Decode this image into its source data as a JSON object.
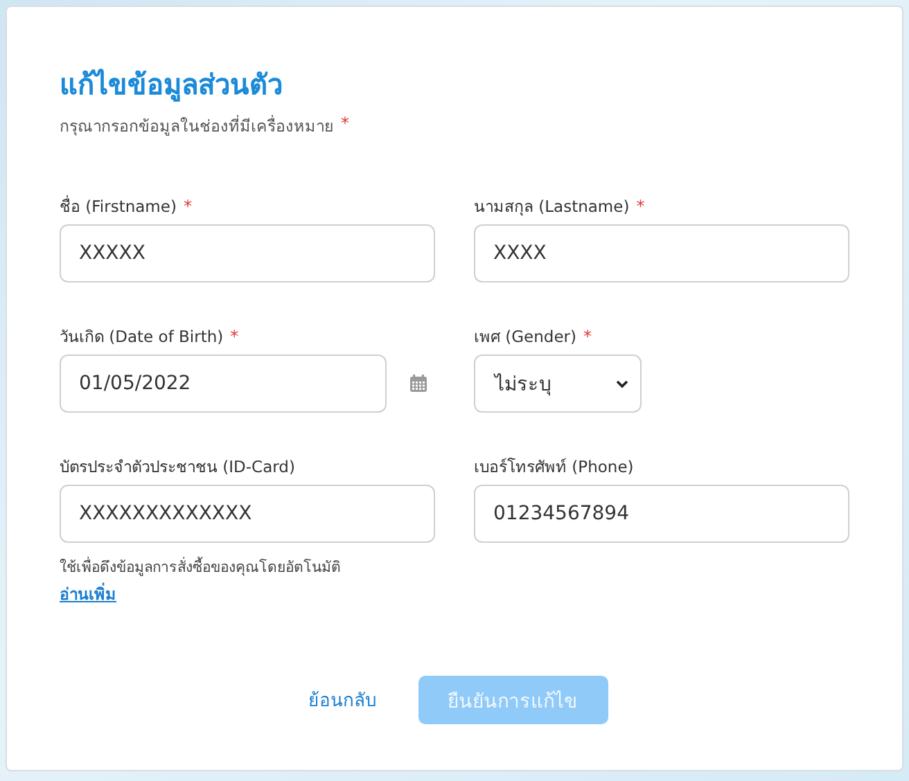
{
  "form": {
    "title": "แก้ไขข้อมูลส่วนตัว",
    "subtitle": "กรุณากรอกข้อมูลในช่องที่มีเครื่องหมาย",
    "required_mark": "*"
  },
  "fields": [
    {
      "kind": "text",
      "label": "ชื่อ (Firstname)",
      "required": true,
      "value": "XXXXX"
    },
    {
      "kind": "text",
      "label": "นามสกุล (Lastname)",
      "required": true,
      "value": "XXXX"
    },
    {
      "kind": "date",
      "label": "วันเกิด (Date of Birth)",
      "required": true,
      "value": "01/05/2022"
    },
    {
      "kind": "select",
      "label": "เพศ (Gender)",
      "required": true,
      "value": "ไม่ระบุ"
    },
    {
      "kind": "text",
      "label": "บัตรประจำตัวประชาชน (ID-Card)",
      "required": false,
      "value": "XXXXXXXXXXXXX",
      "help": "ใช้เพื่อดึงข้อมูลการสั่งซื้อของคุณโดยอัตโนมัติ",
      "link": "อ่านเพิ่ม"
    },
    {
      "kind": "text",
      "label": "เบอร์โทรศัพท์ (Phone)",
      "required": false,
      "value": "01234567894"
    }
  ],
  "buttons": {
    "back": "ย้อนกลับ",
    "confirm": {
      "label": "ยืนยันการแก้ไข",
      "disabled": true
    }
  }
}
